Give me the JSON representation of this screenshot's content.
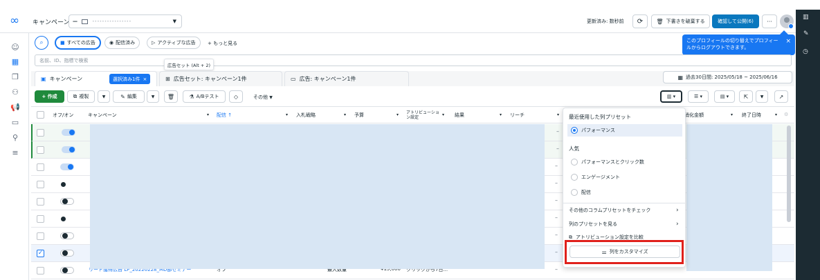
{
  "topbar": {
    "logo_glyph": "∞",
    "title": "キャンペーン",
    "account_short": "—",
    "account_name": "••••••••••••••••",
    "updated_label": "更新済み: 数秒前",
    "discard_label": "下書きを破棄する",
    "publish_label": "確認して公開(6)",
    "more_label": "···"
  },
  "tooltip": {
    "text": "このプロフィールの切り替えでプロフィールからログアウトできます。",
    "close": "×"
  },
  "filters": {
    "all_ads": "すべての広告",
    "delivering": "配信済み",
    "active_ads": "アクティブな広告",
    "more": "+ もっと見る",
    "search_placeholder": "名前、ID、指標で検索"
  },
  "hover_tip": "広告セット (Alt + 2)",
  "tabs": {
    "campaign": "キャンペーン",
    "selected_badge": "選択済み1件",
    "adset": "広告セット: キャンペーン1件",
    "ad": "広告: キャンペーン1件"
  },
  "date_range": "過去30日間: 2025/05/18 ~ 2025/06/16",
  "toolbar": {
    "create": "+ 作成",
    "duplicate": "複製",
    "edit": "編集",
    "abtest": "A/Bテスト",
    "other": "その他"
  },
  "table": {
    "headers": [
      "オフ/オン",
      "キャンペーン",
      "配信 ↑",
      "入札戦略",
      "予算",
      "アトリビューション設定",
      "結果",
      "リーチ",
      "消化金額",
      "終了日時"
    ],
    "rows": [
      {
        "toggle": "on",
        "checked": false
      },
      {
        "toggle": "on",
        "checked": false
      },
      {
        "toggle": "on",
        "checked": false
      },
      {
        "toggle": "off",
        "checked": false
      },
      {
        "toggle": "off",
        "checked": false
      },
      {
        "toggle": "off",
        "checked": false
      },
      {
        "toggle": "off",
        "checked": false
      },
      {
        "toggle": "off",
        "checked": true
      },
      {
        "toggle": "off",
        "checked": false
      }
    ],
    "last_row": {
      "campaign": "リード獲得広告 LP_20220228_MD部セミナー",
      "delivery": "オフ",
      "bid": "最大数量",
      "budget": "¥15,000",
      "attribution": "クリックから7日..."
    }
  },
  "menu": {
    "section_recent": "最近使用した列プリセット",
    "performance": "パフォーマンス",
    "section_popular": "人気",
    "perf_clicks": "パフォーマンスとクリック数",
    "engagement": "エンゲージメント",
    "delivery": "配信",
    "other_presets": "その他のコラムプリセットをチェック",
    "view_presets": "列のプリセットを見る",
    "compare_attribution": "アトリビューション設定を比較",
    "customize": "列をカスタマイズ"
  },
  "colors": {
    "accent": "#1877f2",
    "primary_button": "#0a78be",
    "create": "#1f8a3c",
    "highlight_box": "#e0201b",
    "blur": "#d8e6f4"
  }
}
